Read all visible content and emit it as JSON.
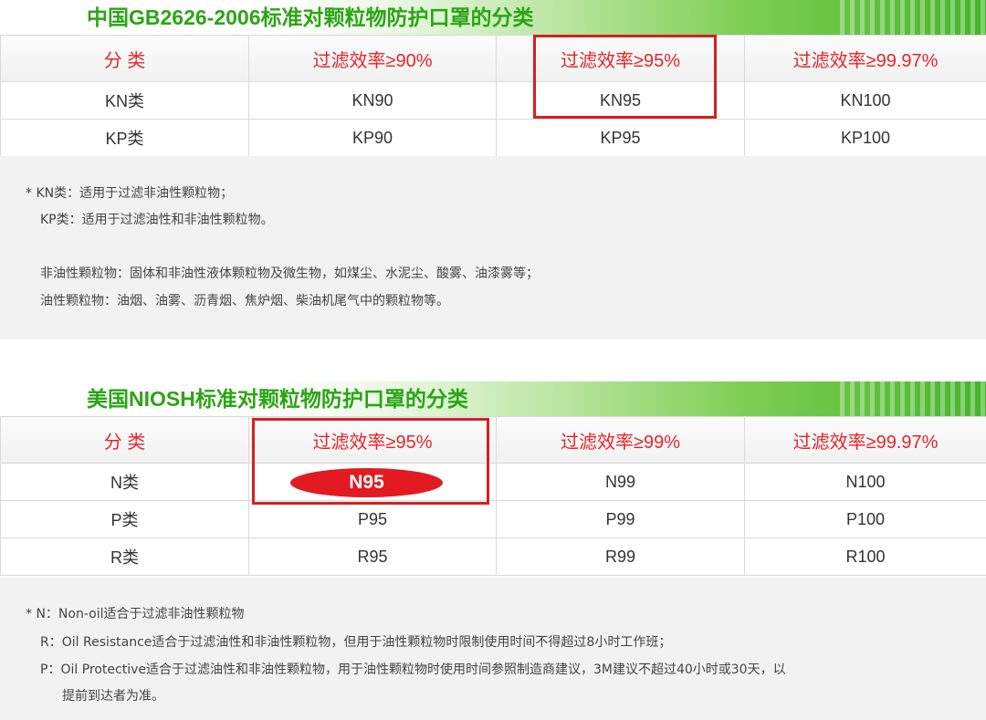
{
  "gb": {
    "title": "中国GB2626-2006标准对颗粒物防护口罩的分类",
    "header": [
      "分 类",
      "过滤效率≥90%",
      "过滤效率≥95%",
      "过滤效率≥99.97%"
    ],
    "rows": [
      [
        "KN类",
        "KN90",
        "KN95",
        "KN100"
      ],
      [
        "KP类",
        "KP90",
        "KP95",
        "KP100"
      ]
    ],
    "notes": [
      "* KN类：适用于过滤非油性颗粒物；",
      "KP类：适用于过滤油性和非油性颗粒物。",
      "非油性颗粒物：固体和非油性液体颗粒物及微生物，如煤尘、水泥尘、酸雾、油漆雾等；",
      "油性颗粒物：油烟、油雾、沥青烟、焦炉烟、柴油机尾气中的颗粒物等。"
    ]
  },
  "niosh": {
    "title": "美国NIOSH标准对颗粒物防护口罩的分类",
    "header": [
      "分 类",
      "过滤效率≥95%",
      "过滤效率≥99%",
      "过滤效率≥99.97%"
    ],
    "rows": [
      [
        "N类",
        "N95",
        "N99",
        "N100"
      ],
      [
        "P类",
        "P95",
        "P99",
        "P100"
      ],
      [
        "R类",
        "R95",
        "R99",
        "R100"
      ]
    ],
    "notes": [
      "* N：Non-oil适合于过滤非油性颗粒物",
      "R：Oil Resistance适合于过滤油性和非油性颗粒物，但用于油性颗粒物时限制使用时间不得超过8小时工作班；",
      "P：Oil Protective适合于过滤油性和非油性颗粒物，用于油性颗粒物时使用时间参照制造商建议，3M建议不超过40小时或30天，以",
      "提前到达者为准。"
    ]
  },
  "colors": {
    "accent_red": "#e2262b",
    "title_green": "#2aa515",
    "band_green": "#45b52a"
  }
}
